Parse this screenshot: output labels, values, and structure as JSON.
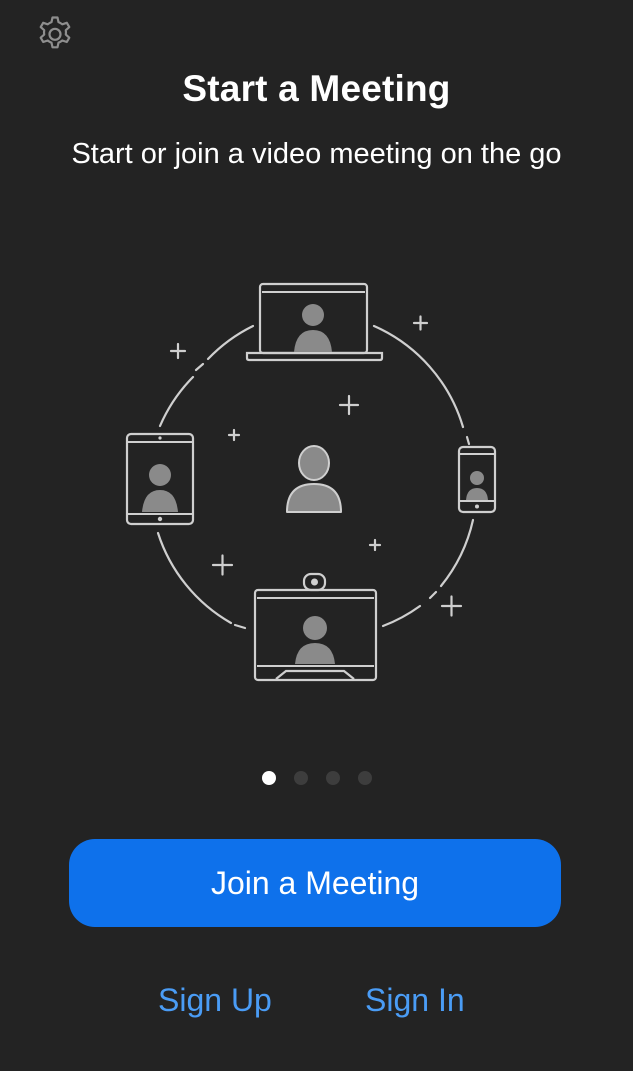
{
  "header": {
    "settings_icon": "gear-icon"
  },
  "intro": {
    "title": "Start a Meeting",
    "subtitle": "Start or join a video meeting on the go"
  },
  "illustration": {
    "icons": [
      "laptop-icon",
      "tablet-icon",
      "phone-icon",
      "room-system-icon",
      "person-icon"
    ]
  },
  "pager": {
    "total": 4,
    "active": 1
  },
  "actions": {
    "join_label": "Join a Meeting",
    "signup_label": "Sign Up",
    "signin_label": "Sign In"
  },
  "colors": {
    "background": "#232323",
    "accent": "#0e71eb",
    "link": "#4a9cf5"
  }
}
